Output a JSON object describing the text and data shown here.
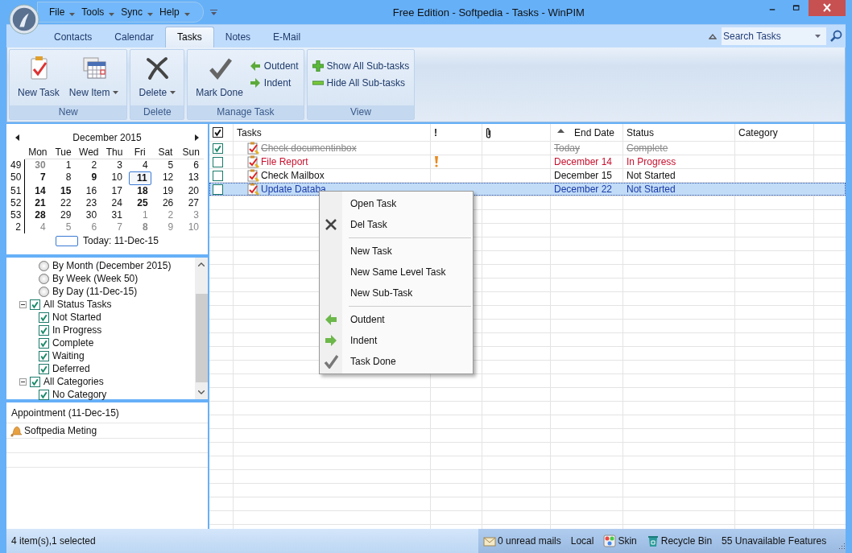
{
  "window": {
    "title": "Free Edition - Softpedia - Tasks - WinPIM"
  },
  "quick_menu": [
    "File",
    "Tools",
    "Sync",
    "Help"
  ],
  "tabs": [
    {
      "label": "Contacts",
      "selected": false
    },
    {
      "label": "Calendar",
      "selected": false
    },
    {
      "label": "Tasks",
      "selected": true
    },
    {
      "label": "Notes",
      "selected": false
    },
    {
      "label": "E-Mail",
      "selected": false
    }
  ],
  "search": {
    "placeholder": "Search Tasks"
  },
  "ribbon": [
    {
      "label": "New",
      "buttons": [
        {
          "label": "New Task",
          "kind": "large",
          "dropdown": false
        },
        {
          "label": "New Item",
          "kind": "large",
          "dropdown": true
        }
      ]
    },
    {
      "label": "Delete",
      "buttons": [
        {
          "label": "Delete",
          "kind": "large",
          "dropdown": true
        }
      ]
    },
    {
      "label": "Manage Task",
      "buttons": [
        {
          "label": "Mark Done",
          "kind": "large",
          "dropdown": false
        },
        {
          "label": "Outdent",
          "kind": "small",
          "dropdown": false
        },
        {
          "label": "Indent",
          "kind": "small",
          "dropdown": false
        }
      ]
    },
    {
      "label": "View",
      "buttons": [
        {
          "label": "Show All Sub-tasks",
          "kind": "small",
          "dropdown": false
        },
        {
          "label": "Hide All Sub-tasks",
          "kind": "small",
          "dropdown": false
        }
      ]
    }
  ],
  "calendar": {
    "month": "December 2015",
    "weekdays": [
      "Mon",
      "Tue",
      "Wed",
      "Thu",
      "Fri",
      "Sat",
      "Sun"
    ],
    "weeks": [
      {
        "number": "49",
        "days": [
          {
            "day": "30",
            "bold": true,
            "other_month": true,
            "selected": false
          },
          {
            "day": "1",
            "bold": false,
            "other_month": false,
            "selected": false
          },
          {
            "day": "2",
            "bold": false,
            "other_month": false,
            "selected": false
          },
          {
            "day": "3",
            "bold": false,
            "other_month": false,
            "selected": false
          },
          {
            "day": "4",
            "bold": false,
            "other_month": false,
            "selected": false
          },
          {
            "day": "5",
            "bold": false,
            "other_month": false,
            "selected": false
          },
          {
            "day": "6",
            "bold": false,
            "other_month": false,
            "selected": false
          }
        ]
      },
      {
        "number": "50",
        "days": [
          {
            "day": "7",
            "bold": true,
            "other_month": false,
            "selected": false
          },
          {
            "day": "8",
            "bold": false,
            "other_month": false,
            "selected": false
          },
          {
            "day": "9",
            "bold": true,
            "other_month": false,
            "selected": false
          },
          {
            "day": "10",
            "bold": false,
            "other_month": false,
            "selected": false
          },
          {
            "day": "11",
            "bold": true,
            "other_month": false,
            "selected": true
          },
          {
            "day": "12",
            "bold": false,
            "other_month": false,
            "selected": false
          },
          {
            "day": "13",
            "bold": false,
            "other_month": false,
            "selected": false
          }
        ]
      },
      {
        "number": "51",
        "days": [
          {
            "day": "14",
            "bold": true,
            "other_month": false,
            "selected": false
          },
          {
            "day": "15",
            "bold": true,
            "other_month": false,
            "selected": false
          },
          {
            "day": "16",
            "bold": false,
            "other_month": false,
            "selected": false
          },
          {
            "day": "17",
            "bold": false,
            "other_month": false,
            "selected": false
          },
          {
            "day": "18",
            "bold": true,
            "other_month": false,
            "selected": false
          },
          {
            "day": "19",
            "bold": false,
            "other_month": false,
            "selected": false
          },
          {
            "day": "20",
            "bold": false,
            "other_month": false,
            "selected": false
          }
        ]
      },
      {
        "number": "52",
        "days": [
          {
            "day": "21",
            "bold": true,
            "other_month": false,
            "selected": false
          },
          {
            "day": "22",
            "bold": false,
            "other_month": false,
            "selected": false
          },
          {
            "day": "23",
            "bold": false,
            "other_month": false,
            "selected": false
          },
          {
            "day": "24",
            "bold": false,
            "other_month": false,
            "selected": false
          },
          {
            "day": "25",
            "bold": true,
            "other_month": false,
            "selected": false
          },
          {
            "day": "26",
            "bold": false,
            "other_month": false,
            "selected": false
          },
          {
            "day": "27",
            "bold": false,
            "other_month": false,
            "selected": false
          }
        ]
      },
      {
        "number": "53",
        "days": [
          {
            "day": "28",
            "bold": true,
            "other_month": false,
            "selected": false
          },
          {
            "day": "29",
            "bold": false,
            "other_month": false,
            "selected": false
          },
          {
            "day": "30",
            "bold": false,
            "other_month": false,
            "selected": false
          },
          {
            "day": "31",
            "bold": false,
            "other_month": false,
            "selected": false
          },
          {
            "day": "1",
            "bold": false,
            "other_month": true,
            "selected": false
          },
          {
            "day": "2",
            "bold": false,
            "other_month": true,
            "selected": false
          },
          {
            "day": "3",
            "bold": false,
            "other_month": true,
            "selected": false
          }
        ]
      },
      {
        "number": "2",
        "days": [
          {
            "day": "4",
            "bold": false,
            "other_month": true,
            "selected": false
          },
          {
            "day": "5",
            "bold": false,
            "other_month": true,
            "selected": false
          },
          {
            "day": "6",
            "bold": false,
            "other_month": true,
            "selected": false
          },
          {
            "day": "7",
            "bold": false,
            "other_month": true,
            "selected": false
          },
          {
            "day": "8",
            "bold": true,
            "other_month": true,
            "selected": false
          },
          {
            "day": "9",
            "bold": false,
            "other_month": true,
            "selected": false
          },
          {
            "day": "10",
            "bold": false,
            "other_month": true,
            "selected": false
          }
        ]
      }
    ],
    "today": "Today: 11-Dec-15"
  },
  "tree": [
    {
      "label": "By Month (December 2015)",
      "kind": "radio",
      "checked": false
    },
    {
      "label": "By Week (Week 50)",
      "kind": "radio",
      "checked": false
    },
    {
      "label": "By Day (11-Dec-15)",
      "kind": "radio",
      "checked": false
    },
    {
      "label": "All Status Tasks",
      "kind": "checkbox",
      "checked": true,
      "expanded": true,
      "children": [
        {
          "label": "Not Started",
          "checked": true
        },
        {
          "label": "In Progress",
          "checked": true
        },
        {
          "label": "Complete",
          "checked": true
        },
        {
          "label": "Waiting",
          "checked": true
        },
        {
          "label": "Deferred",
          "checked": true
        }
      ]
    },
    {
      "label": "All Categories",
      "kind": "checkbox",
      "checked": true,
      "expanded": true,
      "children": [
        {
          "label": "No Category",
          "checked": true
        }
      ]
    }
  ],
  "appointments": {
    "title": "Appointment (11-Dec-15)",
    "items": [
      "Softpedia Meting"
    ]
  },
  "task_table": {
    "all_checked": true,
    "columns": [
      {
        "label": "Tasks",
        "kind": "text",
        "sorted": false
      },
      {
        "label": "!",
        "kind": "text",
        "sorted": false
      },
      {
        "kind": "attachment",
        "sorted": false
      },
      {
        "label": "End Date",
        "kind": "text",
        "sorted": true
      },
      {
        "label": "Status",
        "kind": "text",
        "sorted": false
      },
      {
        "label": "Category",
        "kind": "text",
        "sorted": false
      }
    ],
    "rows": [
      {
        "done": true,
        "name": "Check documentinbox",
        "high_priority": false,
        "end_date": "Today",
        "status": "Complete",
        "overdue": false,
        "selected": false
      },
      {
        "done": false,
        "name": "File Report",
        "high_priority": true,
        "end_date": "December 14",
        "status": "In Progress",
        "overdue": true,
        "selected": false
      },
      {
        "done": false,
        "name": "Check Mailbox",
        "high_priority": false,
        "end_date": "December 15",
        "status": "Not Started",
        "overdue": false,
        "selected": false
      },
      {
        "done": false,
        "name": "Update Databa",
        "high_priority": false,
        "end_date": "December 22",
        "status": "Not Started",
        "overdue": false,
        "selected": true
      }
    ]
  },
  "context_menu": {
    "groups": [
      [
        "Open Task",
        "Del Task"
      ],
      [
        "New Task",
        "New Same Level Task",
        "New Sub-Task"
      ],
      [
        "Outdent",
        "Indent",
        "Task Done"
      ]
    ]
  },
  "status_bar": {
    "text": "4 item(s),1 selected",
    "items": [
      "0 unread mails",
      "Local",
      "Skin",
      "Recycle Bin",
      "55 Unavailable Features"
    ]
  }
}
